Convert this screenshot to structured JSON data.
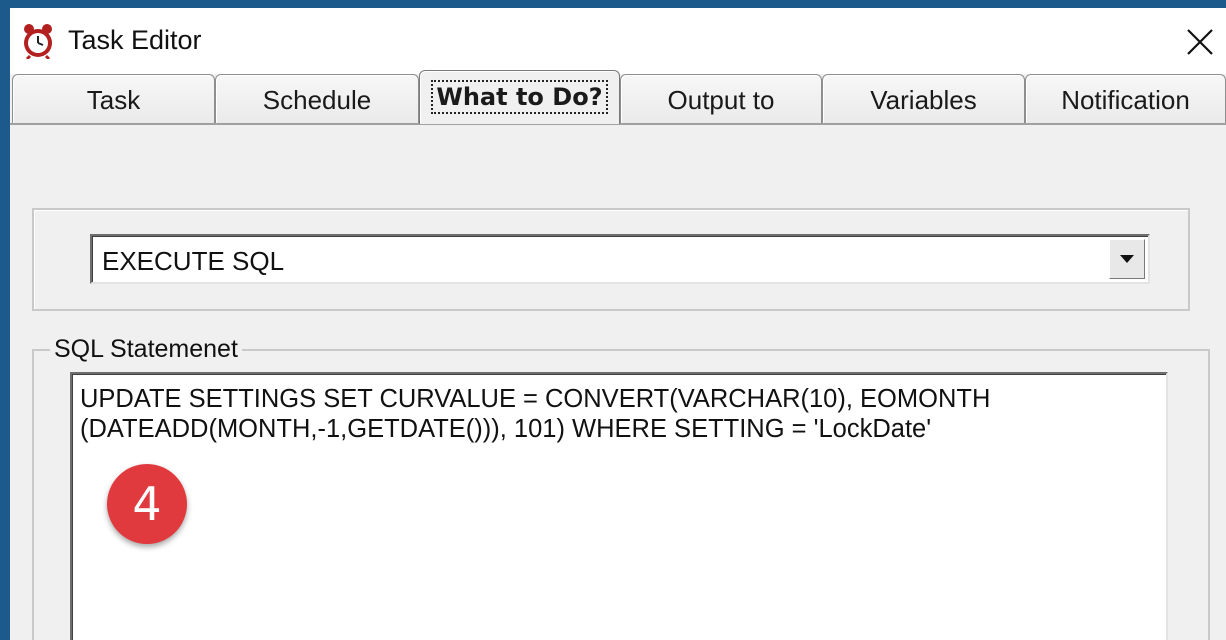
{
  "window": {
    "title": "Task Editor"
  },
  "tabs": [
    {
      "label": "Task"
    },
    {
      "label": "Schedule"
    },
    {
      "label": "What to Do?"
    },
    {
      "label": "Output to"
    },
    {
      "label": "Variables"
    },
    {
      "label": "Notification"
    }
  ],
  "action": {
    "selected": "EXECUTE SQL"
  },
  "sql": {
    "group_label": "SQL Statemenet",
    "statement": "UPDATE SETTINGS SET CURVALUE = CONVERT(VARCHAR(10), EOMONTH\n(DATEADD(MONTH,-1,GETDATE())), 101) WHERE SETTING = 'LockDate'"
  },
  "annotation": {
    "step": "4",
    "color": "#e0393e"
  }
}
